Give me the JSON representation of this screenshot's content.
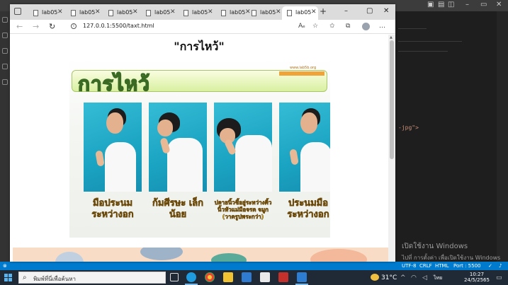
{
  "vscode": {
    "code_fragment": "-jpg\">",
    "activation": {
      "title": "เปิดใช้งาน Windows",
      "subtitle": "ไปที่ การตั้งค่า เพื่อเปิดใช้งาน Windows"
    },
    "status": {
      "encoding": "UTF-8",
      "eol": "CRLF",
      "language": "HTML",
      "port": "Port : 5500"
    }
  },
  "taskbar": {
    "search_placeholder": "พิมพ์ที่นี่เพื่อค้นหา",
    "temperature": "31°C",
    "lang": "ไทย",
    "time": "10:27",
    "date": "24/5/2565"
  },
  "browser": {
    "tabs": [
      {
        "label": "lab05",
        "active": false
      },
      {
        "label": "lab05",
        "active": false
      },
      {
        "label": "lab05",
        "active": false
      },
      {
        "label": "lab05",
        "active": false
      },
      {
        "label": "lab05",
        "active": false
      },
      {
        "label": "lab05",
        "active": false
      },
      {
        "label": "lab05",
        "active": false
      },
      {
        "label": "lab05",
        "active": true
      }
    ],
    "address": "127.0.0.1:5500/taxt.html",
    "read_aloud": "Aₑ"
  },
  "page": {
    "title": "\"การไหว้\"",
    "poster": {
      "heading": "การไหว้",
      "site": "www.lab5b.org",
      "captions": [
        "มือประนม ระหว่างอก",
        "ก้มศีรษะ เล็กน้อย",
        "ปลายนิ้วชี้อยู่ระหว่างคิ้ว นิ้วหัวแม่มือจรด จมูก (วาดรูปพระกว่า)",
        "ประนมมือ ระหว่างอก"
      ]
    }
  },
  "colors": {
    "accent": "#007acc",
    "poster_cyan": "#1aa3c2",
    "caption_yellow": "#ffd23a"
  }
}
